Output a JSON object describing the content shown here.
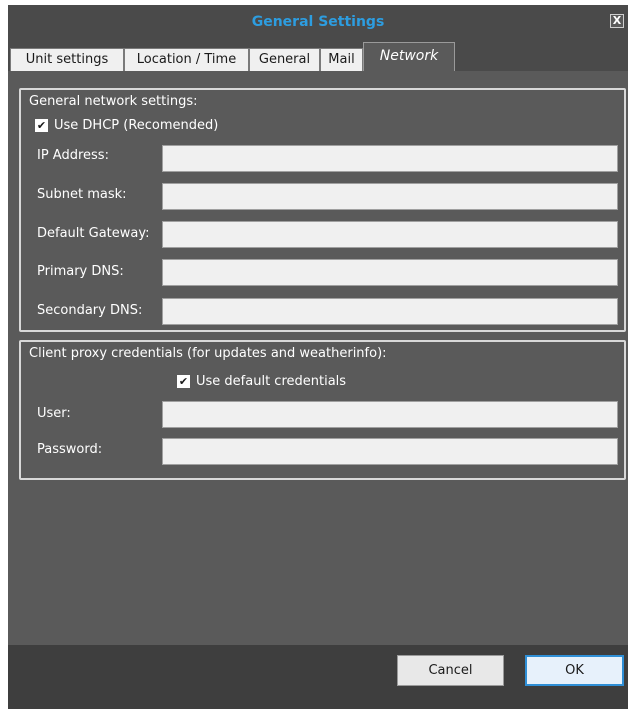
{
  "window": {
    "title": "General Settings",
    "close_symbol": "X"
  },
  "tabs": [
    {
      "label": "Unit settings",
      "active": false
    },
    {
      "label": "Location / Time",
      "active": false
    },
    {
      "label": "General",
      "active": false
    },
    {
      "label": "Mail",
      "active": false
    },
    {
      "label": "Network",
      "active": true
    }
  ],
  "network": {
    "group_title": "General network settings:",
    "dhcp_label": "Use DHCP (Recomended)",
    "dhcp_checked": true,
    "fields": [
      {
        "label": "IP Address:",
        "value": ""
      },
      {
        "label": "Subnet mask:",
        "value": ""
      },
      {
        "label": "Default Gateway:",
        "value": ""
      },
      {
        "label": "Primary DNS:",
        "value": ""
      },
      {
        "label": "Secondary DNS:",
        "value": ""
      }
    ]
  },
  "proxy": {
    "group_title": "Client proxy credentials (for updates and weatherinfo):",
    "default_credentials_label": "Use default credentials",
    "default_credentials_checked": true,
    "fields": [
      {
        "label": "User:",
        "value": ""
      },
      {
        "label": "Password:",
        "value": ""
      }
    ]
  },
  "buttons": {
    "cancel": "Cancel",
    "ok": "OK"
  },
  "colors": {
    "title": "#2d9de0",
    "ok_border": "#2f8fd6",
    "background": "#5a5a5a"
  },
  "icons": {
    "close": "close-icon",
    "check": "checkmark-icon"
  }
}
